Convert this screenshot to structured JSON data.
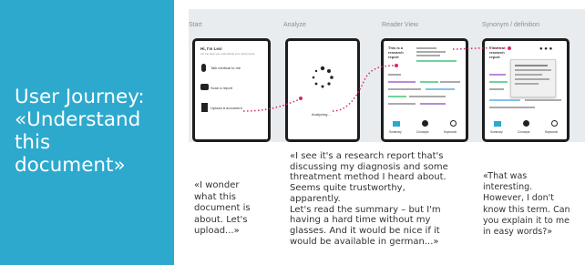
{
  "sidebar": {
    "title": "User Journey:\n«Understand\nthis\ndocument»",
    "background": "#2ea9ce"
  },
  "stages": [
    {
      "label": "Start"
    },
    {
      "label": "Analyze"
    },
    {
      "label": "Reader View"
    },
    {
      "label": "Synonym / definition"
    }
  ],
  "screens": {
    "start": {
      "greeting": "Hi, I'm Lexi",
      "subtitle": "Let me help you understand your documents",
      "options": [
        "Talk medical to me",
        "Scan a report",
        "Upload a document"
      ]
    },
    "analyze": {
      "status": "Analyzing..."
    },
    "reader": {
      "heading": "This is a research report",
      "nav": [
        "Summary",
        "Concepts",
        "Keywords"
      ]
    },
    "synonym": {
      "heading": "This is a research report",
      "nav": [
        "Summary",
        "Concepts",
        "Keywords"
      ]
    }
  },
  "quotes": [
    "«I wonder\nwhat this\ndocument is\nabout. Let's\nupload...»",
    "«I see it's a research report that's\ndiscussing my diagnosis and some\nthreatment method I heard about.\nSeems quite trustworthy,\napparently.\nLet's read the summary – but I'm\nhaving a hard time without my\nglasses. And it would be nice if it\nwould be available in german...»",
    "«That was\ninteresting.\nHowever, I don't\nknow this term. Can\nyou explain it to me\nin easy words?»"
  ],
  "colors": {
    "accent": "#2ea9ce",
    "path": "#d7266f",
    "highlight_green": "#6fd39a",
    "highlight_purple": "#b98ad8",
    "highlight_blue": "#7fc4e8"
  }
}
